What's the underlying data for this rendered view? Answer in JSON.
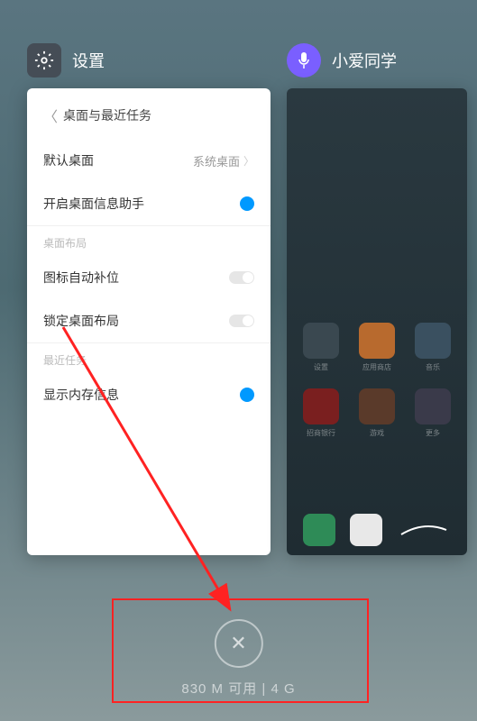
{
  "apps": {
    "settings": {
      "title": "设置"
    },
    "ai": {
      "title": "小爱同学"
    }
  },
  "settings_panel": {
    "title": "桌面与最近任务",
    "default_desktop": {
      "label": "默认桌面",
      "value": "系统桌面"
    },
    "info_assistant": {
      "label": "开启桌面信息助手"
    },
    "section_layout": "桌面布局",
    "auto_fill": {
      "label": "图标自动补位"
    },
    "lock_layout": {
      "label": "锁定桌面布局"
    },
    "section_recent": "最近任务",
    "show_memory": {
      "label": "显示内存信息"
    }
  },
  "memory": {
    "text": "830 M 可用 | 4 G"
  },
  "home_apps": {
    "a1": "设置",
    "a2": "应用商店",
    "a3": "音乐",
    "a4": "招商银行",
    "a5": "游戏",
    "a6": "更多"
  }
}
